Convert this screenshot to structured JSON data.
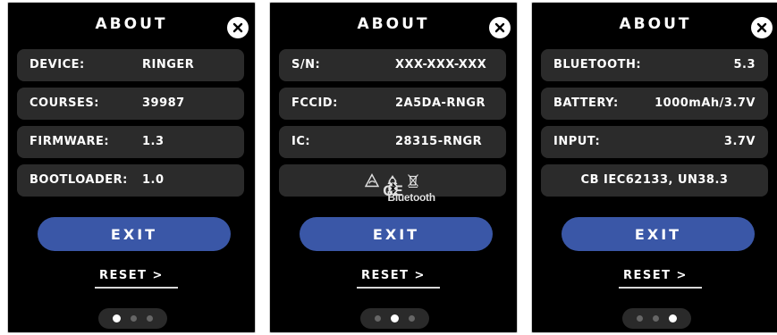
{
  "screens": [
    {
      "title": "ABOUT",
      "rows": [
        {
          "label": "DEVICE:",
          "value": "RINGER"
        },
        {
          "label": "COURSES:",
          "value": "39987"
        },
        {
          "label": "FIRMWARE:",
          "value": "1.3"
        },
        {
          "label": "BOOTLOADER:",
          "value": "1.0"
        }
      ],
      "exit_label": "EXIT",
      "reset_label": "RESET >",
      "page_index": 1,
      "page_count": 3
    },
    {
      "title": "ABOUT",
      "rows": [
        {
          "label": "S/N:",
          "value": "XXX-XXX-XXX"
        },
        {
          "label": "FCCID:",
          "value": "2A5DA-RNGR"
        },
        {
          "label": "IC:",
          "value": "28315-RNGR"
        }
      ],
      "cert_icons": {
        "ce": "CE",
        "ukca_top": "UK",
        "ukca_bottom": "CA",
        "rcm": "rcm-icon",
        "recycle": "recycle-icon",
        "weee": "weee-bin-icon",
        "bluetooth": "Bluetooth"
      },
      "exit_label": "EXIT",
      "reset_label": "RESET >",
      "page_index": 2,
      "page_count": 3
    },
    {
      "title": "ABOUT",
      "rows": [
        {
          "label": "BLUETOOTH:",
          "value": "5.3"
        },
        {
          "label": "BATTERY:",
          "value": "1000mAh/3.7V"
        },
        {
          "label": "INPUT:",
          "value": "3.7V"
        }
      ],
      "cert_text": "CB IEC62133, UN38.3",
      "exit_label": "EXIT",
      "reset_label": "RESET >",
      "page_index": 3,
      "page_count": 3
    }
  ],
  "colors": {
    "screen_bg": "#000000",
    "row_bg": "#2b2b2b",
    "exit_bg": "#3a57a7",
    "text": "#ffffff"
  }
}
